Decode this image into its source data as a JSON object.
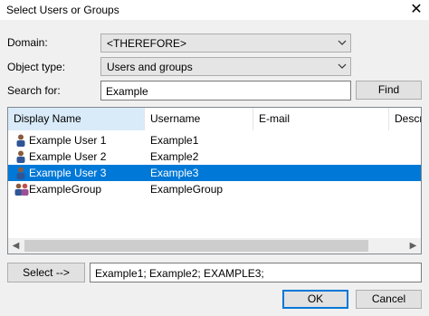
{
  "window": {
    "title": "Select Users or Groups"
  },
  "domain": {
    "label": "Domain:",
    "value": "<THEREFORE>"
  },
  "object_type": {
    "label": "Object type:",
    "value": "Users and groups"
  },
  "search": {
    "label": "Search for:",
    "value": "Example",
    "find_label": "Find"
  },
  "list": {
    "columns": [
      "Display Name",
      "Username",
      "E-mail",
      "Descrip"
    ],
    "rows": [
      {
        "display_name": "Example User 1",
        "username": "Example1",
        "icon": "user-icon",
        "selected": false
      },
      {
        "display_name": "Example User 2",
        "username": "Example2",
        "icon": "user-icon",
        "selected": false
      },
      {
        "display_name": "Example User 3",
        "username": "Example3",
        "icon": "user-icon",
        "selected": true
      },
      {
        "display_name": "ExampleGroup",
        "username": "ExampleGroup",
        "icon": "group-icon",
        "selected": false
      }
    ]
  },
  "selection": {
    "select_label": "Select -->",
    "result": "Example1; Example2; EXAMPLE3;"
  },
  "footer": {
    "ok_label": "OK",
    "cancel_label": "Cancel"
  },
  "colors": {
    "selection": "#0078d7",
    "sorted_header": "#d9ebf9"
  }
}
